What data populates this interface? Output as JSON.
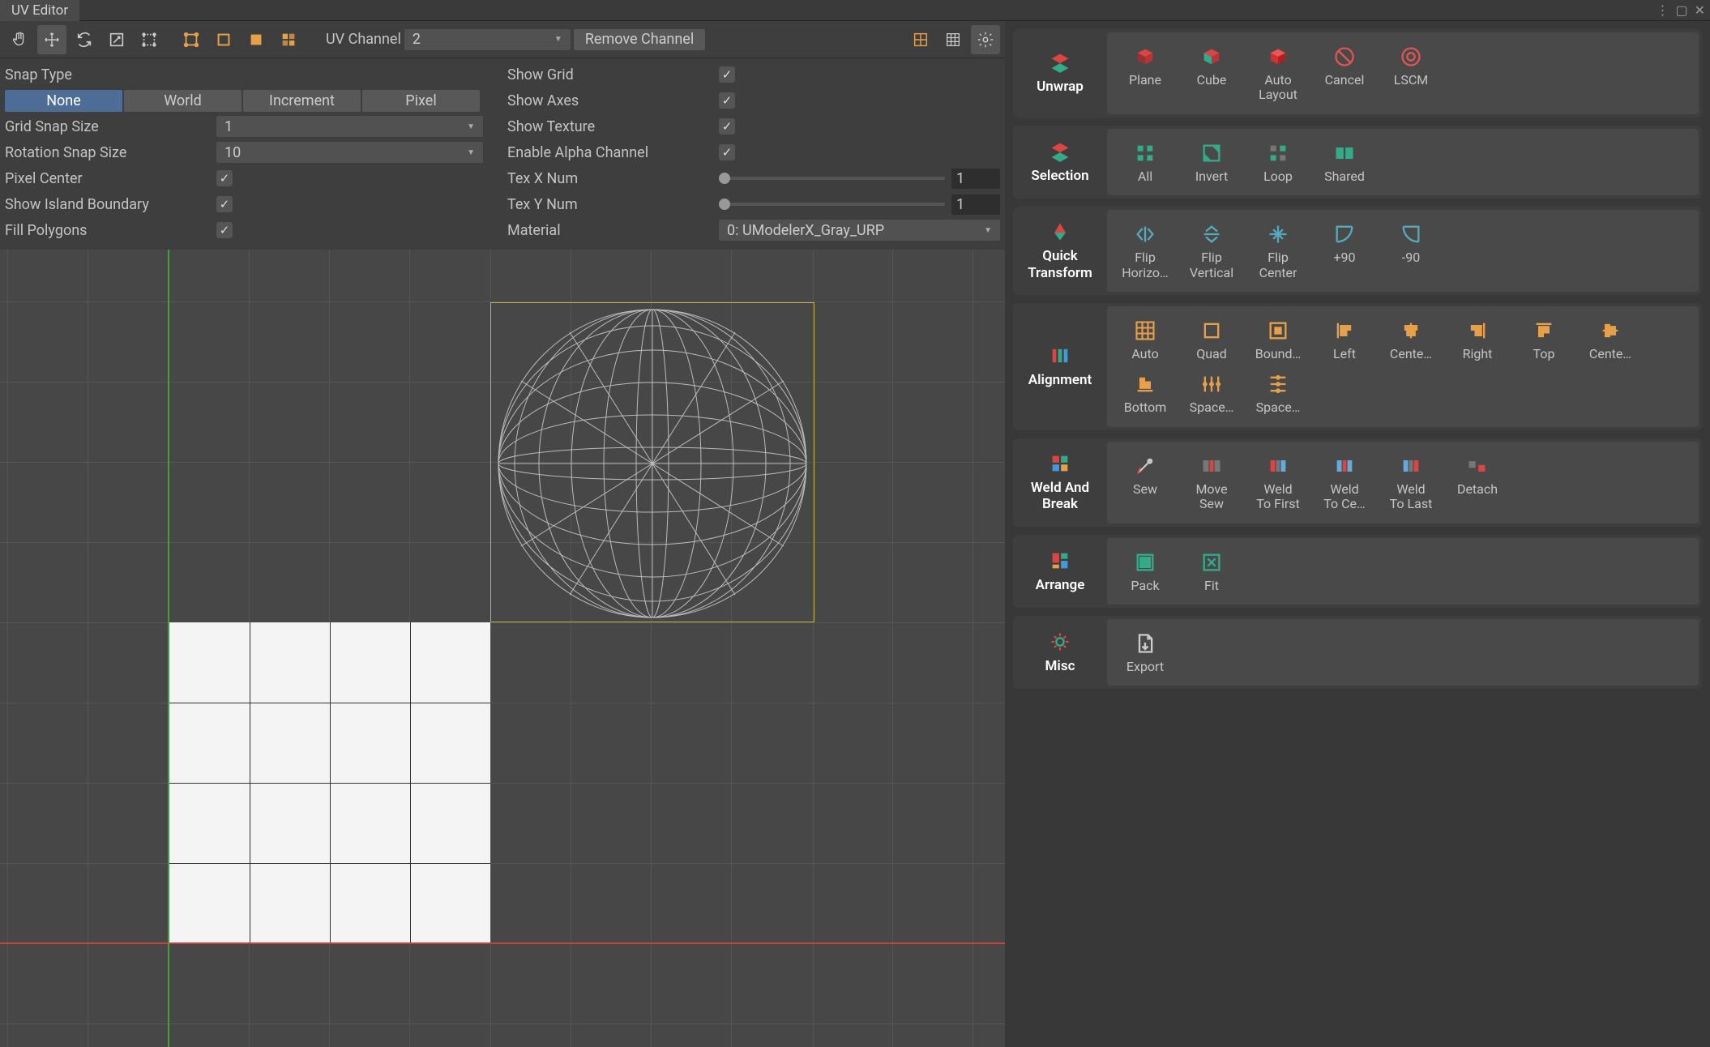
{
  "window": {
    "title": "UV Editor"
  },
  "toolbar": {
    "uv_channel_label": "UV Channel",
    "uv_channel_value": "2",
    "remove_channel": "Remove Channel"
  },
  "settings_left": {
    "snap_type_label": "Snap Type",
    "snap_options": [
      "None",
      "World",
      "Increment",
      "Pixel"
    ],
    "snap_selected": "None",
    "grid_snap_size_label": "Grid Snap Size",
    "grid_snap_size_value": "1",
    "rotation_snap_size_label": "Rotation Snap Size",
    "rotation_snap_size_value": "10",
    "pixel_center_label": "Pixel Center",
    "pixel_center_checked": true,
    "show_island_boundary_label": "Show Island Boundary",
    "show_island_boundary_checked": true,
    "fill_polygons_label": "Fill Polygons",
    "fill_polygons_checked": true
  },
  "settings_right": {
    "show_grid_label": "Show Grid",
    "show_grid_checked": true,
    "show_axes_label": "Show Axes",
    "show_axes_checked": true,
    "show_texture_label": "Show Texture",
    "show_texture_checked": true,
    "enable_alpha_label": "Enable Alpha Channel",
    "enable_alpha_checked": true,
    "tex_x_label": "Tex X Num",
    "tex_x_value": "1",
    "tex_y_label": "Tex Y Num",
    "tex_y_value": "1",
    "material_label": "Material",
    "material_value": "0: UModelerX_Gray_URP"
  },
  "panels": {
    "unwrap": {
      "title": "Unwrap",
      "items": [
        "Plane",
        "Cube",
        "Auto\nLayout",
        "Cancel",
        "LSCM"
      ]
    },
    "selection": {
      "title": "Selection",
      "items": [
        "All",
        "Invert",
        "Loop",
        "Shared"
      ]
    },
    "quick_transform": {
      "title": "Quick\nTransform",
      "items": [
        "Flip\nHorizo…",
        "Flip\nVertical",
        "Flip\nCenter",
        "+90",
        "-90"
      ]
    },
    "alignment": {
      "title": "Alignment",
      "items": [
        "Auto",
        "Quad",
        "Bound…",
        "Left",
        "Cente…",
        "Right",
        "Top",
        "Cente…",
        "Bottom",
        "Space…",
        "Space…"
      ]
    },
    "weld_break": {
      "title": "Weld\nAnd Break",
      "items": [
        "Sew",
        "Move\nSew",
        "Weld\nTo First",
        "Weld\nTo Ce…",
        "Weld\nTo Last",
        "Detach"
      ]
    },
    "arrange": {
      "title": "Arrange",
      "items": [
        "Pack",
        "Fit"
      ]
    },
    "misc": {
      "title": "Misc",
      "items": [
        "Export"
      ]
    }
  }
}
